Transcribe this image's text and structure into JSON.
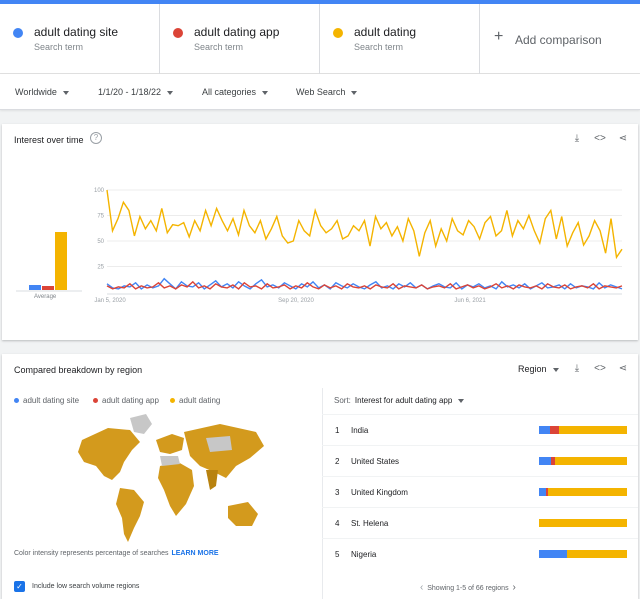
{
  "colors": {
    "blue": "#4285f4",
    "red": "#db4437",
    "yellow": "#f4b400",
    "accent": "#1a73e8"
  },
  "terms": [
    {
      "name": "adult dating site",
      "sub": "Search term",
      "color": "#4285f4"
    },
    {
      "name": "adult dating app",
      "sub": "Search term",
      "color": "#db4437"
    },
    {
      "name": "adult dating",
      "sub": "Search term",
      "color": "#f4b400"
    }
  ],
  "add_comparison": "Add comparison",
  "filters": {
    "geo": "Worldwide",
    "date": "1/1/20 - 1/18/22",
    "category": "All categories",
    "property": "Web Search"
  },
  "interest": {
    "title": "Interest over time",
    "help_icon": "help-icon",
    "average_label": "Average"
  },
  "chart_data": {
    "type": "line",
    "title": "Interest over time",
    "ylim": [
      0,
      100
    ],
    "y_ticks": [
      "100",
      "75",
      "50",
      "25"
    ],
    "x_tick_labels": [
      "Jan 5, 2020",
      "Sep 20, 2020",
      "Jun 6, 2021"
    ],
    "averages": {
      "adult dating site": 5,
      "adult dating app": 4,
      "adult dating": 58
    },
    "series": [
      {
        "name": "adult dating site",
        "color": "#4285f4",
        "values": [
          8,
          4,
          3,
          6,
          5,
          9,
          3,
          7,
          4,
          6,
          13,
          8,
          3,
          10,
          6,
          5,
          9,
          3,
          7,
          11,
          5,
          8,
          4,
          10,
          6,
          3,
          8,
          12,
          5,
          7,
          4,
          9,
          6,
          3,
          8,
          5,
          10,
          4,
          7,
          3,
          9,
          6,
          4,
          8,
          5,
          3,
          7,
          10,
          4,
          6,
          3,
          8,
          5,
          9,
          4,
          7,
          3,
          6,
          8,
          5,
          4,
          9,
          3,
          7,
          5,
          8,
          4,
          6,
          3,
          10,
          5,
          7,
          4,
          8,
          3,
          6,
          9,
          4,
          5,
          7,
          3,
          8,
          4,
          6,
          5,
          3,
          9,
          4,
          7,
          5,
          3
        ]
      },
      {
        "name": "adult dating app",
        "color": "#db4437",
        "values": [
          6,
          3,
          5,
          4,
          8,
          3,
          6,
          4,
          5,
          9,
          4,
          6,
          3,
          7,
          5,
          10,
          4,
          6,
          3,
          8,
          5,
          4,
          7,
          3,
          9,
          5,
          6,
          3,
          8,
          4,
          5,
          7,
          3,
          6,
          4,
          9,
          5,
          3,
          7,
          4,
          6,
          3,
          8,
          5,
          4,
          6,
          3,
          7,
          5,
          4,
          8,
          3,
          6,
          5,
          4,
          7,
          3,
          5,
          6,
          4,
          8,
          3,
          5,
          7,
          4,
          6,
          3,
          5,
          8,
          4,
          6,
          3,
          7,
          5,
          4,
          6,
          3,
          8,
          5,
          4,
          7,
          3,
          5,
          6,
          4,
          8,
          3,
          6,
          5,
          4,
          6
        ]
      },
      {
        "name": "adult dating",
        "color": "#f4b400",
        "values": [
          100,
          60,
          72,
          88,
          80,
          55,
          74,
          62,
          70,
          60,
          82,
          58,
          66,
          65,
          68,
          54,
          70,
          60,
          80,
          65,
          82,
          70,
          60,
          72,
          56,
          80,
          65,
          58,
          70,
          52,
          62,
          74,
          55,
          48,
          50,
          70,
          60,
          55,
          80,
          65,
          58,
          62,
          70,
          52,
          55,
          65,
          60,
          70,
          45,
          74,
          62,
          68,
          55,
          64,
          50,
          72,
          60,
          35,
          58,
          70,
          45,
          62,
          50,
          72,
          60,
          56,
          70,
          64,
          52,
          68,
          74,
          55,
          60,
          80,
          55,
          70,
          62,
          75,
          60,
          48,
          72,
          80,
          52,
          74,
          45,
          58,
          68,
          46,
          55,
          70,
          60,
          38,
          72,
          34,
          42
        ]
      }
    ]
  },
  "region": {
    "title": "Compared breakdown by region",
    "selector": "Region",
    "legend": [
      "adult dating site",
      "adult dating app",
      "adult dating"
    ],
    "sort_label": "Sort:",
    "sort_value": "Interest for adult dating app",
    "rows": [
      {
        "rank": "1",
        "name": "India",
        "blue": 0.13,
        "red": 0.1,
        "yellow": 0.77
      },
      {
        "rank": "2",
        "name": "United States",
        "blue": 0.14,
        "red": 0.04,
        "yellow": 0.82
      },
      {
        "rank": "3",
        "name": "United Kingdom",
        "blue": 0.08,
        "red": 0.02,
        "yellow": 0.9
      },
      {
        "rank": "4",
        "name": "St. Helena",
        "blue": 0,
        "red": 0,
        "yellow": 1
      },
      {
        "rank": "5",
        "name": "Nigeria",
        "blue": 0.32,
        "red": 0,
        "yellow": 0.68
      }
    ],
    "color_note": "Color intensity represents percentage of searches",
    "learn_more": "LEARN MORE",
    "include_low": "Include low search volume regions",
    "pager": "Showing 1-5 of 66 regions"
  }
}
